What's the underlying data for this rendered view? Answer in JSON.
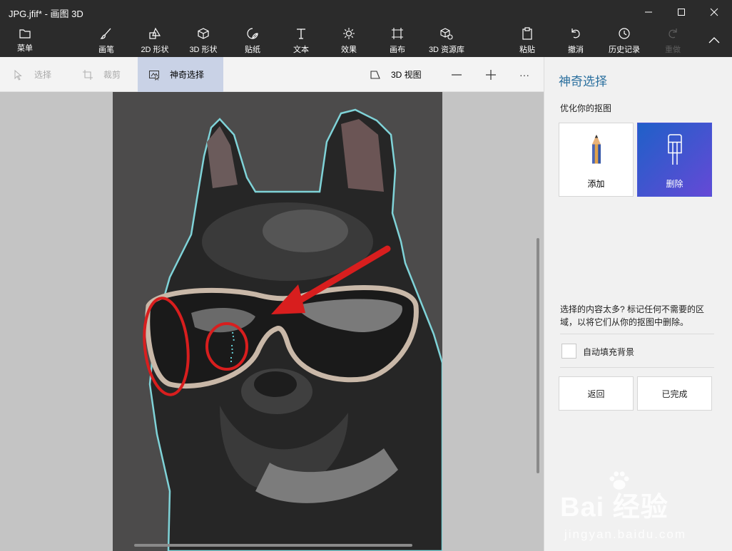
{
  "window": {
    "title": "JPG.jfif* - 画图 3D",
    "controls": [
      "minimize",
      "maximize",
      "close"
    ]
  },
  "ribbon": {
    "menu_label": "菜单",
    "tools": [
      {
        "label": "画笔",
        "icon": "brush-icon"
      },
      {
        "label": "2D 形状",
        "icon": "shapes-2d-icon"
      },
      {
        "label": "3D 形状",
        "icon": "cube-icon"
      },
      {
        "label": "贴纸",
        "icon": "sticker-icon"
      },
      {
        "label": "文本",
        "icon": "text-icon"
      },
      {
        "label": "效果",
        "icon": "effects-icon"
      },
      {
        "label": "画布",
        "icon": "canvas-icon"
      },
      {
        "label": "3D 资源库",
        "icon": "library-icon"
      }
    ],
    "paste_label": "粘贴",
    "undo_label": "撤消",
    "history_label": "历史记录",
    "redo_label": "重做"
  },
  "subtoolbar": {
    "select_label": "选择",
    "crop_label": "裁剪",
    "magic_select_label": "神奇选择",
    "view3d_label": "3D 视图",
    "more_label": "···"
  },
  "panel": {
    "title": "神奇选择",
    "subtitle": "优化你的抠图",
    "add_label": "添加",
    "remove_label": "删除",
    "hint": "选择的内容太多? 标记任何不需要的区域，以将它们从你的抠图中删除。",
    "autofill_label": "自动填充背景",
    "autofill_checked": false,
    "back_label": "返回",
    "done_label": "已完成"
  },
  "watermark": {
    "brand": "Bai 经验",
    "url": "jingyan.baidu.com"
  },
  "colors": {
    "accent": "#2a6f9e",
    "selected_tool": "#4a56d6",
    "annotation": "#d81e1e",
    "ribbon_bg": "#2b2b2b"
  }
}
